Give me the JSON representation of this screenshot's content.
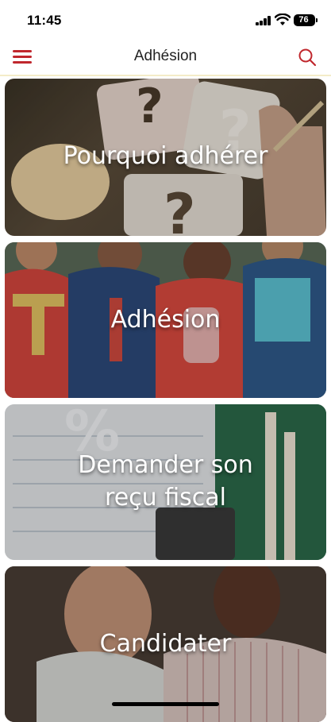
{
  "status_bar": {
    "time": "11:45",
    "battery": "76"
  },
  "header": {
    "title": "Adhésion"
  },
  "cards": [
    {
      "label_lines": [
        "Pourquoi adhérer"
      ]
    },
    {
      "label_lines": [
        "Adhésion"
      ]
    },
    {
      "label_lines": [
        "Demander son",
        "reçu fiscal"
      ]
    },
    {
      "label_lines": [
        "Candidater"
      ]
    }
  ],
  "colors": {
    "accent": "#c0272d",
    "header_border": "#f4ecc8"
  },
  "icons": {
    "menu": "hamburger-menu-icon",
    "search": "search-icon"
  }
}
